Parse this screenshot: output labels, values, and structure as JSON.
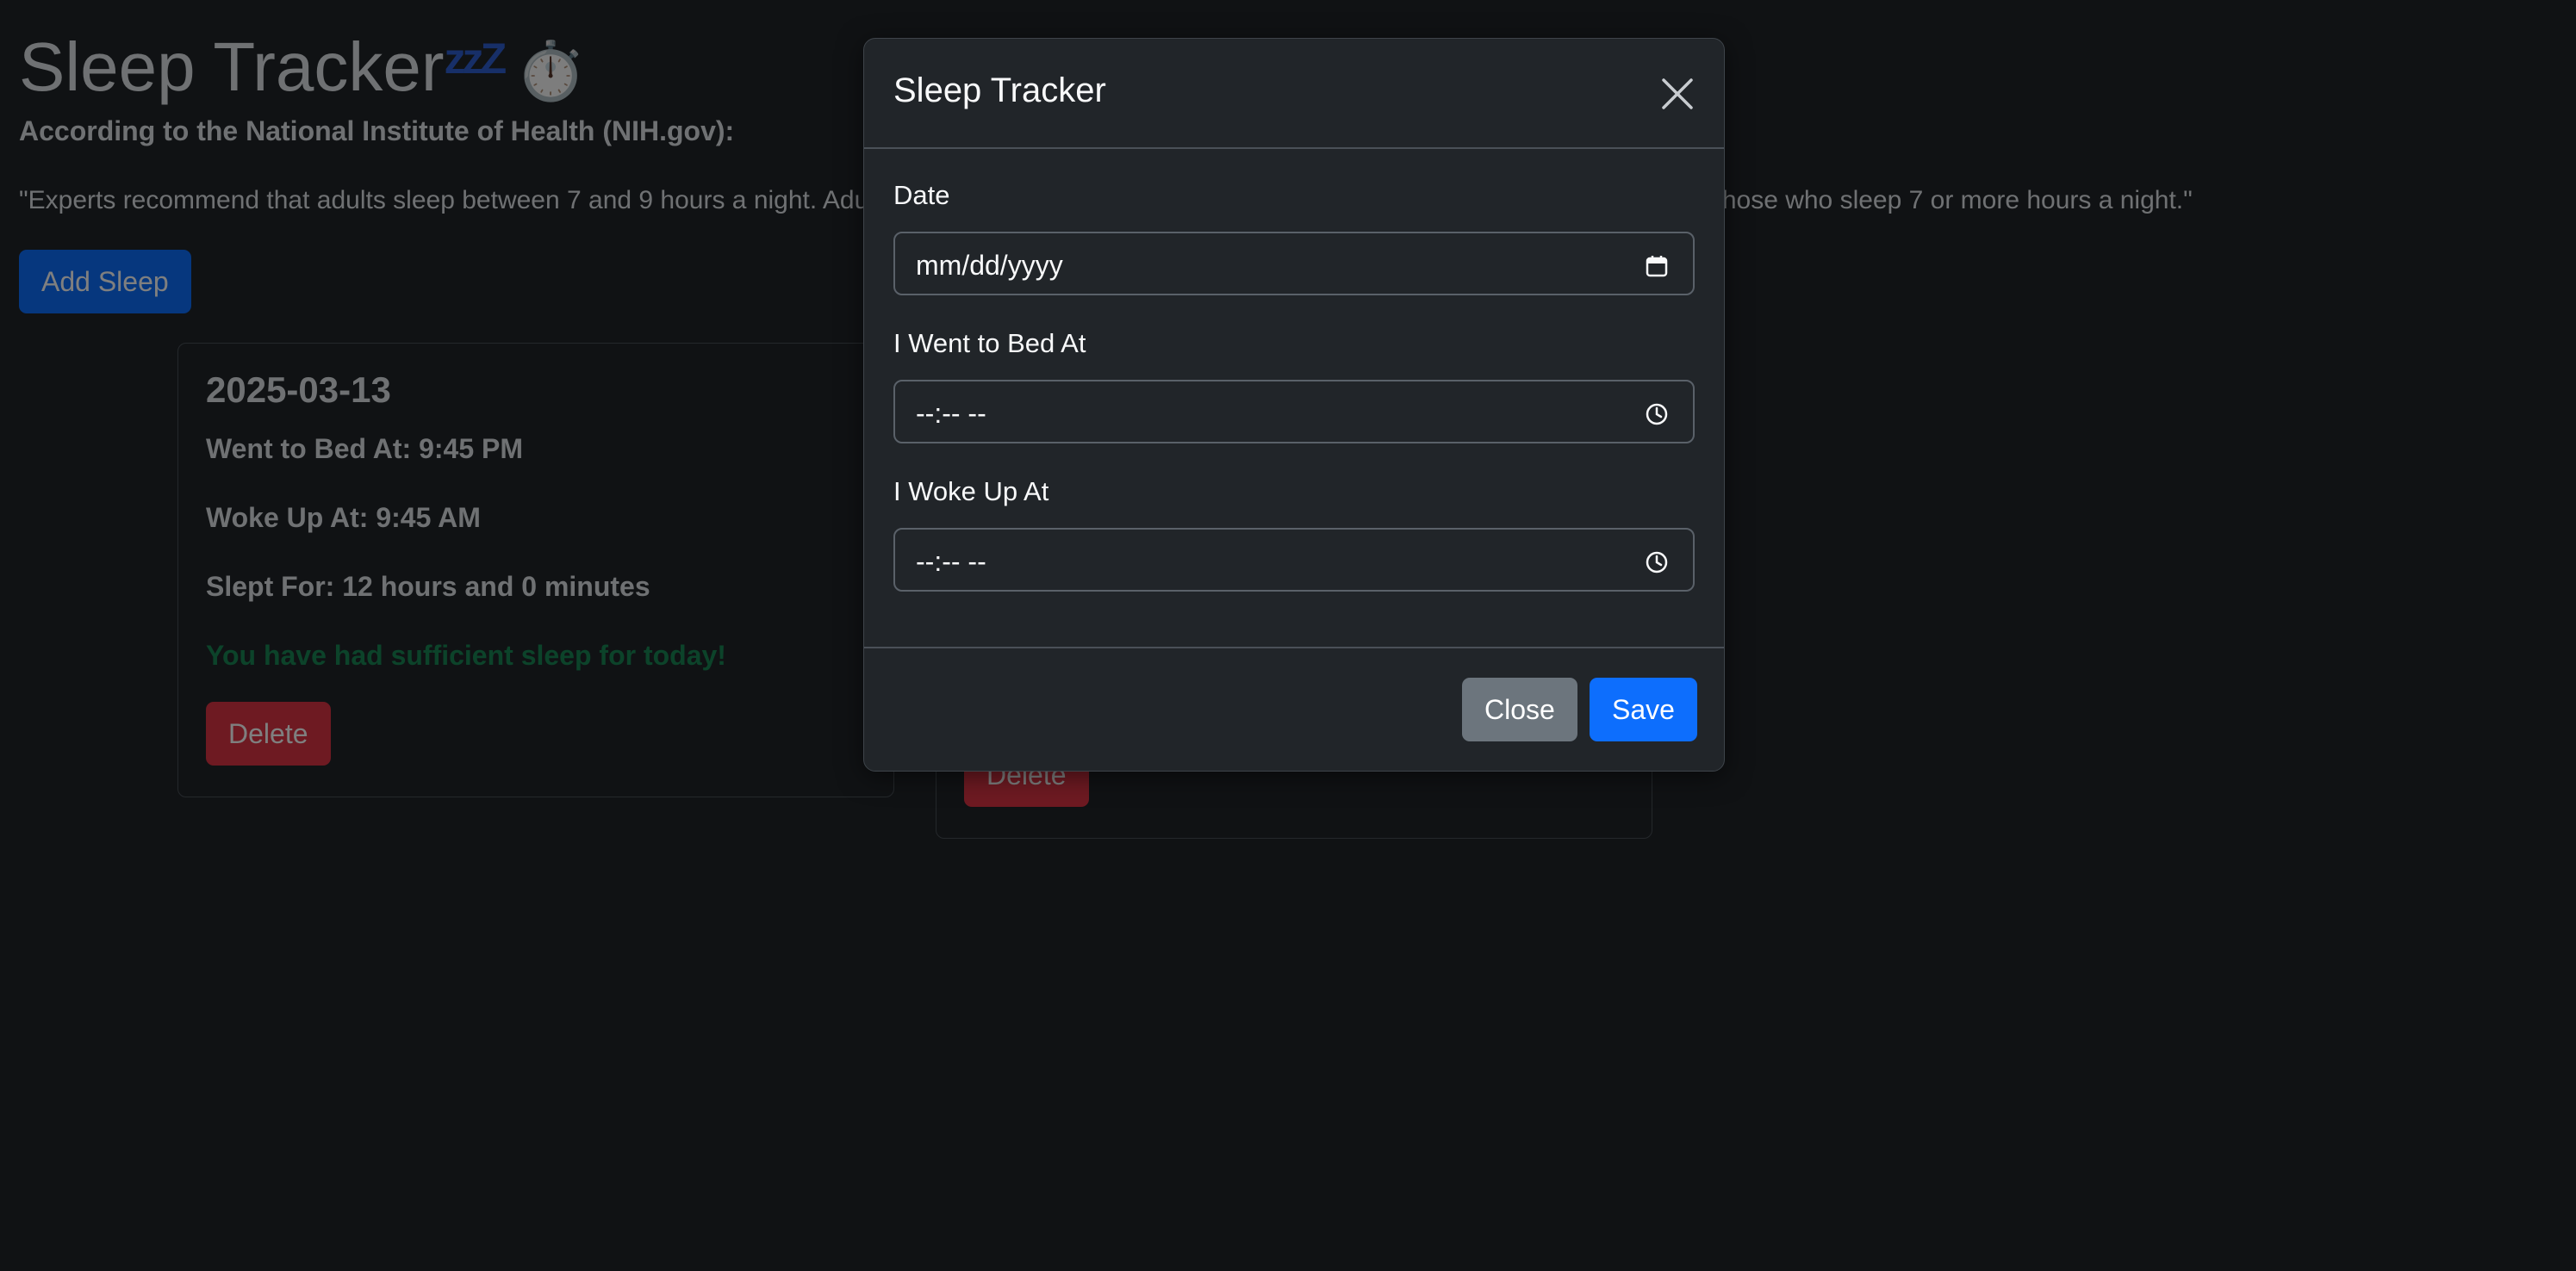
{
  "page": {
    "title": "Sleep Tracker",
    "title_zzz": "zzZ",
    "title_emoji": "⏱️",
    "nih_heading": "According to the National Institute of Health (NIH.gov):",
    "quote": "\"Experts recommend that adults sleep between 7 and 9 hours a night. Adults who sleep less than 7 hours a night may have more health issues than those who sleep 7 or more hours a night.\"",
    "add_button": "Add Sleep"
  },
  "cards": [
    {
      "date": "2025-03-13",
      "bed": "Went to Bed At: 9:45 PM",
      "woke": "Woke Up At: 9:45 AM",
      "slept": "Slept For: 12 hours and 0 minutes",
      "status": "You have had sufficient sleep for today!",
      "delete_label": "Delete"
    },
    {
      "delete_label": "Delete"
    }
  ],
  "modal": {
    "title": "Sleep Tracker",
    "date_label": "Date",
    "date_value": "mm/dd/yyyy",
    "bed_label": "I Went to Bed At",
    "bed_value": "--:-- --",
    "woke_label": "I Woke Up At",
    "woke_value": "--:-- --",
    "close_label": "Close",
    "save_label": "Save"
  },
  "colors": {
    "primary": "#0d6efd",
    "danger": "#dc3545",
    "success": "#198754",
    "secondary": "#6c757d",
    "background": "#212529"
  }
}
